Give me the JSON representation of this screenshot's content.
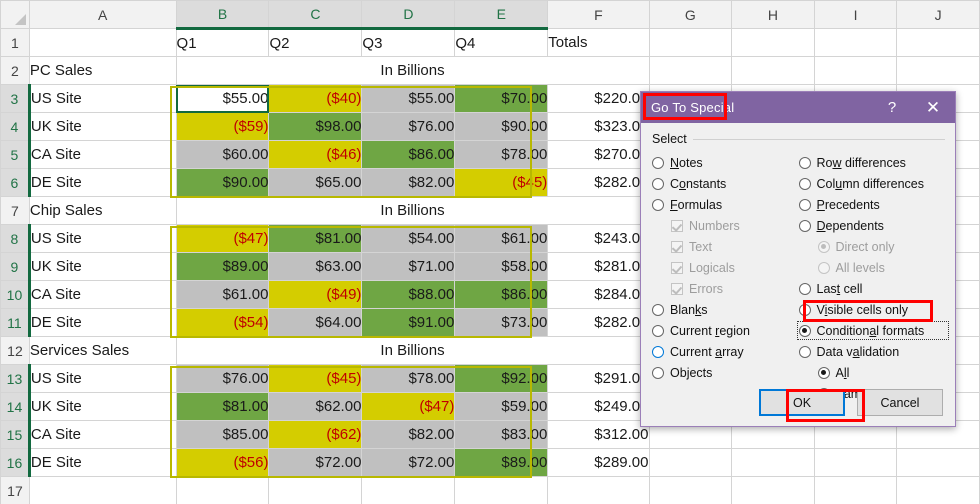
{
  "sheet": {
    "column_headers": [
      "A",
      "B",
      "C",
      "D",
      "E",
      "F",
      "G",
      "H",
      "I",
      "J"
    ],
    "selected_columns": [
      "B",
      "C",
      "D",
      "E"
    ],
    "row_numbers": [
      "1",
      "2",
      "3",
      "4",
      "5",
      "6",
      "7",
      "8",
      "9",
      "10",
      "11",
      "12",
      "13",
      "14",
      "15",
      "16",
      "17"
    ],
    "selected_rows": [
      "3",
      "4",
      "5",
      "6",
      "8",
      "9",
      "10",
      "11",
      "13",
      "14",
      "15",
      "16"
    ],
    "active_cell": "B3",
    "header_row": {
      "a": "",
      "quarters": [
        "Q1",
        "Q2",
        "Q3",
        "Q4"
      ],
      "totals": "Totals"
    },
    "merged_label": "In Billions",
    "sections": [
      {
        "title": "PC Sales",
        "rows": [
          {
            "label": "US Site",
            "cells": [
              {
                "text": "$55.00",
                "fill": "none",
                "neg": false
              },
              {
                "text": "($40)",
                "fill": "yellow",
                "neg": true
              },
              {
                "text": "$55.00",
                "fill": "silver",
                "neg": false
              },
              {
                "text": "$70.00",
                "fill": "green",
                "neg": false
              }
            ],
            "total": "$220.00"
          },
          {
            "label": "UK Site",
            "cells": [
              {
                "text": "($59)",
                "fill": "yellow",
                "neg": true
              },
              {
                "text": "$98.00",
                "fill": "green",
                "neg": false
              },
              {
                "text": "$76.00",
                "fill": "silver",
                "neg": false
              },
              {
                "text": "$90.00",
                "fill": "silver",
                "neg": false
              }
            ],
            "total": "$323.00"
          },
          {
            "label": "CA Site",
            "cells": [
              {
                "text": "$60.00",
                "fill": "silver",
                "neg": false
              },
              {
                "text": "($46)",
                "fill": "yellow",
                "neg": true
              },
              {
                "text": "$86.00",
                "fill": "green",
                "neg": false
              },
              {
                "text": "$78.00",
                "fill": "silver",
                "neg": false
              }
            ],
            "total": "$270.00"
          },
          {
            "label": "DE Site",
            "cells": [
              {
                "text": "$90.00",
                "fill": "green",
                "neg": false
              },
              {
                "text": "$65.00",
                "fill": "silver",
                "neg": false
              },
              {
                "text": "$82.00",
                "fill": "silver",
                "neg": false
              },
              {
                "text": "($45)",
                "fill": "yellow",
                "neg": true
              }
            ],
            "total": "$282.00"
          }
        ]
      },
      {
        "title": "Chip Sales",
        "rows": [
          {
            "label": "US Site",
            "cells": [
              {
                "text": "($47)",
                "fill": "yellow",
                "neg": true
              },
              {
                "text": "$81.00",
                "fill": "green",
                "neg": false
              },
              {
                "text": "$54.00",
                "fill": "silver",
                "neg": false
              },
              {
                "text": "$61.00",
                "fill": "silver",
                "neg": false
              }
            ],
            "total": "$243.00"
          },
          {
            "label": "UK Site",
            "cells": [
              {
                "text": "$89.00",
                "fill": "green",
                "neg": false
              },
              {
                "text": "$63.00",
                "fill": "silver",
                "neg": false
              },
              {
                "text": "$71.00",
                "fill": "silver",
                "neg": false
              },
              {
                "text": "$58.00",
                "fill": "silver",
                "neg": false
              }
            ],
            "total": "$281.00"
          },
          {
            "label": "CA Site",
            "cells": [
              {
                "text": "$61.00",
                "fill": "silver",
                "neg": false
              },
              {
                "text": "($49)",
                "fill": "yellow",
                "neg": true
              },
              {
                "text": "$88.00",
                "fill": "green",
                "neg": false
              },
              {
                "text": "$86.00",
                "fill": "green",
                "neg": false
              }
            ],
            "total": "$284.00"
          },
          {
            "label": "DE Site",
            "cells": [
              {
                "text": "($54)",
                "fill": "yellow",
                "neg": true
              },
              {
                "text": "$64.00",
                "fill": "silver",
                "neg": false
              },
              {
                "text": "$91.00",
                "fill": "green",
                "neg": false
              },
              {
                "text": "$73.00",
                "fill": "silver",
                "neg": false
              }
            ],
            "total": "$282.00"
          }
        ]
      },
      {
        "title": "Services Sales",
        "rows": [
          {
            "label": "US Site",
            "cells": [
              {
                "text": "$76.00",
                "fill": "silver",
                "neg": false
              },
              {
                "text": "($45)",
                "fill": "yellow",
                "neg": true
              },
              {
                "text": "$78.00",
                "fill": "silver",
                "neg": false
              },
              {
                "text": "$92.00",
                "fill": "green",
                "neg": false
              }
            ],
            "total": "$291.00"
          },
          {
            "label": "UK Site",
            "cells": [
              {
                "text": "$81.00",
                "fill": "green",
                "neg": false
              },
              {
                "text": "$62.00",
                "fill": "silver",
                "neg": false
              },
              {
                "text": "($47)",
                "fill": "yellow",
                "neg": true
              },
              {
                "text": "$59.00",
                "fill": "silver",
                "neg": false
              }
            ],
            "total": "$249.00"
          },
          {
            "label": "CA Site",
            "cells": [
              {
                "text": "$85.00",
                "fill": "silver",
                "neg": false
              },
              {
                "text": "($62)",
                "fill": "yellow",
                "neg": true
              },
              {
                "text": "$82.00",
                "fill": "silver",
                "neg": false
              },
              {
                "text": "$83.00",
                "fill": "silver",
                "neg": false
              }
            ],
            "total": "$312.00"
          },
          {
            "label": "DE Site",
            "cells": [
              {
                "text": "($56)",
                "fill": "yellow",
                "neg": true
              },
              {
                "text": "$72.00",
                "fill": "silver",
                "neg": false
              },
              {
                "text": "$72.00",
                "fill": "silver",
                "neg": false
              },
              {
                "text": "$89.00",
                "fill": "green",
                "neg": false
              }
            ],
            "total": "$289.00"
          }
        ]
      }
    ]
  },
  "dialog": {
    "title": "Go To Special",
    "help_glyph": "?",
    "close_glyph": "✕",
    "group_label": "Select",
    "left_options": [
      {
        "label": "Notes",
        "type": "radio",
        "state": "off",
        "indent": false,
        "dim": false,
        "accel": 0
      },
      {
        "label": "Constants",
        "type": "radio",
        "state": "off",
        "indent": false,
        "dim": false,
        "accel": 1
      },
      {
        "label": "Formulas",
        "type": "radio",
        "state": "off",
        "indent": false,
        "dim": false,
        "accel": 0
      },
      {
        "label": "Numbers",
        "type": "checkbox",
        "state": "checked",
        "indent": true,
        "dim": true,
        "accel": -1
      },
      {
        "label": "Text",
        "type": "checkbox",
        "state": "checked",
        "indent": true,
        "dim": true,
        "accel": -1
      },
      {
        "label": "Logicals",
        "type": "checkbox",
        "state": "checked",
        "indent": true,
        "dim": true,
        "accel": -1
      },
      {
        "label": "Errors",
        "type": "checkbox",
        "state": "checked",
        "indent": true,
        "dim": true,
        "accel": -1
      },
      {
        "label": "Blanks",
        "type": "radio",
        "state": "off",
        "indent": false,
        "dim": false,
        "accel": 4
      },
      {
        "label": "Current region",
        "type": "radio",
        "state": "off",
        "indent": false,
        "dim": false,
        "accel": 8
      },
      {
        "label": "Current array",
        "type": "radio",
        "state": "hover",
        "indent": false,
        "dim": false,
        "accel": 8
      },
      {
        "label": "Objects",
        "type": "radio",
        "state": "off",
        "indent": false,
        "dim": false,
        "accel": 2
      }
    ],
    "right_options": [
      {
        "label": "Row differences",
        "type": "radio",
        "state": "off",
        "indent": false,
        "dim": false,
        "accel": 2
      },
      {
        "label": "Column differences",
        "type": "radio",
        "state": "off",
        "indent": false,
        "dim": false,
        "accel": 3
      },
      {
        "label": "Precedents",
        "type": "radio",
        "state": "off",
        "indent": false,
        "dim": false,
        "accel": 0
      },
      {
        "label": "Dependents",
        "type": "radio",
        "state": "off",
        "indent": false,
        "dim": false,
        "accel": 0
      },
      {
        "label": "Direct only",
        "type": "radio",
        "state": "on",
        "indent": true,
        "dim": true,
        "accel": -1
      },
      {
        "label": "All levels",
        "type": "radio",
        "state": "off",
        "indent": true,
        "dim": true,
        "accel": -1
      },
      {
        "label": "Last cell",
        "type": "radio",
        "state": "off",
        "indent": false,
        "dim": false,
        "accel": 3
      },
      {
        "label": "Visible cells only",
        "type": "radio",
        "state": "off",
        "indent": false,
        "dim": false,
        "accel": 1
      },
      {
        "label": "Conditional formats",
        "type": "radio",
        "state": "on",
        "indent": false,
        "dim": false,
        "accel": 9,
        "focused": true
      },
      {
        "label": "Data validation",
        "type": "radio",
        "state": "off",
        "indent": false,
        "dim": false,
        "accel": 6
      },
      {
        "label": "All",
        "type": "radio",
        "state": "on",
        "indent": true,
        "dim": false,
        "accel": 1
      },
      {
        "label": "Same",
        "type": "radio",
        "state": "off",
        "indent": true,
        "dim": false,
        "accel": 3
      }
    ],
    "ok_label": "OK",
    "cancel_label": "Cancel"
  },
  "colors": {
    "title_bar": "#8064a2",
    "fill_yellow": "#d4cd00",
    "fill_green": "#6fa644",
    "fill_silver": "#c0c0c0",
    "negative_text": "#c00000",
    "annotation": "#ff0000",
    "default_button_border": "#0078d7",
    "selection_green": "#12693f"
  },
  "annotations": [
    {
      "name": "title-highlight"
    },
    {
      "name": "conditional-formats-highlight"
    },
    {
      "name": "ok-button-highlight"
    }
  ]
}
